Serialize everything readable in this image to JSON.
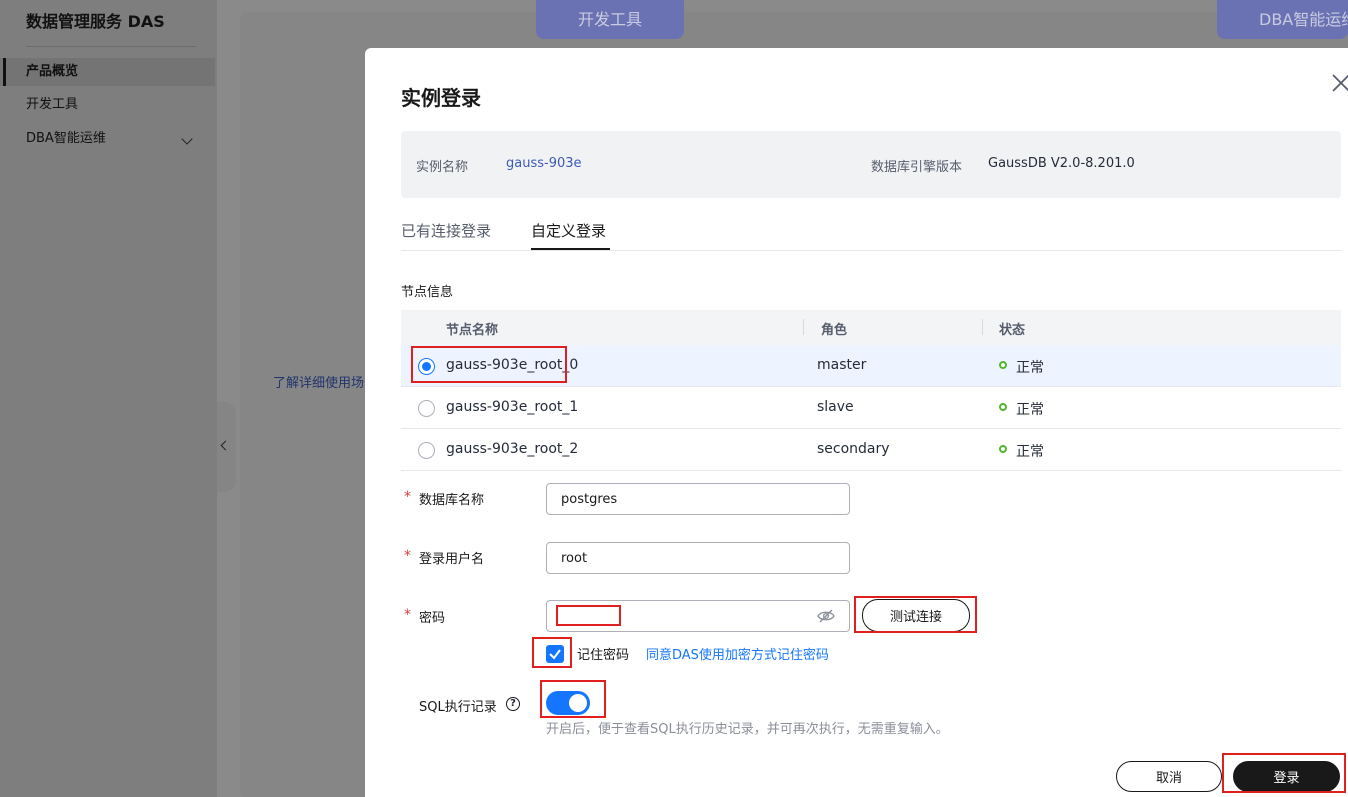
{
  "sidebar": {
    "title": "数据管理服务 DAS",
    "items": [
      {
        "label": "产品概览"
      },
      {
        "label": "开发工具"
      },
      {
        "label": "DBA智能运维"
      }
    ]
  },
  "background": {
    "tab_dev_tools": "开发工具",
    "tab_dba": "DBA智能运维",
    "learn_link": "了解详细使用场景"
  },
  "modal": {
    "title": "实例登录",
    "instance_name_label": "实例名称",
    "instance_name": "gauss-903e",
    "engine_version_label": "数据库引擎版本",
    "engine_version": "GaussDB V2.0-8.201.0",
    "tabs": [
      {
        "label": "已有连接登录"
      },
      {
        "label": "自定义登录"
      }
    ],
    "node_info_label": "节点信息",
    "table": {
      "headers": [
        "节点名称",
        "角色",
        "状态"
      ],
      "rows": [
        {
          "name": "gauss-903e_root_0",
          "role": "master",
          "status": "正常"
        },
        {
          "name": "gauss-903e_root_1",
          "role": "slave",
          "status": "正常"
        },
        {
          "name": "gauss-903e_root_2",
          "role": "secondary",
          "status": "正常"
        }
      ],
      "selected_row": 0
    },
    "form": {
      "db_name_label": "数据库名称",
      "db_name_value": "postgres",
      "username_label": "登录用户名",
      "username_value": "root",
      "password_label": "密码",
      "password_value": "",
      "test_button": "测试连接",
      "remember_label": "记住密码",
      "remember_checked": true,
      "remember_link": "同意DAS使用加密方式记住密码",
      "sql_record_label": "SQL执行记录",
      "sql_record_on": true,
      "sql_record_hint": "开启后，便于查看SQL执行历史记录，并可再次执行，无需重复输入。"
    },
    "cancel_button": "取消",
    "login_button": "登录"
  },
  "colors": {
    "primary": "#1476ff",
    "highlight": "#e0201f",
    "status_ok": "#50b82a",
    "dark_button": "#191919"
  }
}
